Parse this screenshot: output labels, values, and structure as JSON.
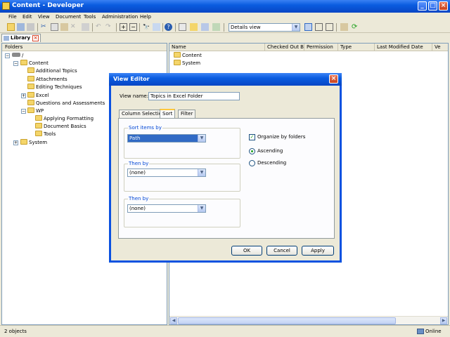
{
  "window": {
    "title": "Content - Developer"
  },
  "menu": [
    "File",
    "Edit",
    "View",
    "Document",
    "Tools",
    "Administration",
    "Help"
  ],
  "toolbar": {
    "view_select": "Details view"
  },
  "library_tab": {
    "label": "Library"
  },
  "folders_pane": {
    "header": "Folders",
    "root": "/",
    "items": [
      {
        "label": "Content",
        "level": 1
      },
      {
        "label": "Additional Topics",
        "level": 2
      },
      {
        "label": "Attachments",
        "level": 2
      },
      {
        "label": "Editing Techniques",
        "level": 2
      },
      {
        "label": "Excel",
        "level": 2
      },
      {
        "label": "Questions and Assessments",
        "level": 2
      },
      {
        "label": "WP",
        "level": 2
      },
      {
        "label": "Applying Formatting",
        "level": 3
      },
      {
        "label": "Document Basics",
        "level": 3
      },
      {
        "label": "Tools",
        "level": 3
      },
      {
        "label": "System",
        "level": 1
      }
    ]
  },
  "details_pane": {
    "columns": [
      "Name",
      "Checked Out By",
      "Permission",
      "Type",
      "Last Modified Date",
      "Ve"
    ],
    "rows": [
      "Content",
      "System"
    ]
  },
  "status": {
    "left": "2 objects",
    "right": "Online"
  },
  "dialog": {
    "title": "View Editor",
    "view_name_label": "View name:",
    "view_name_value": "Topics in Excel Folder",
    "tabs": [
      "Column Selection",
      "Sort",
      "Filter"
    ],
    "sort_items_label": "Sort items by",
    "sort_items_value": "Path",
    "then_by_1_label": "Then by",
    "then_by_1_value": "(none)",
    "then_by_2_label": "Then by",
    "then_by_2_value": "(none)",
    "organize_label": "Organize by folders",
    "ascending_label": "Ascending",
    "descending_label": "Descending",
    "ok_label": "OK",
    "cancel_label": "Cancel",
    "apply_label": "Apply"
  }
}
